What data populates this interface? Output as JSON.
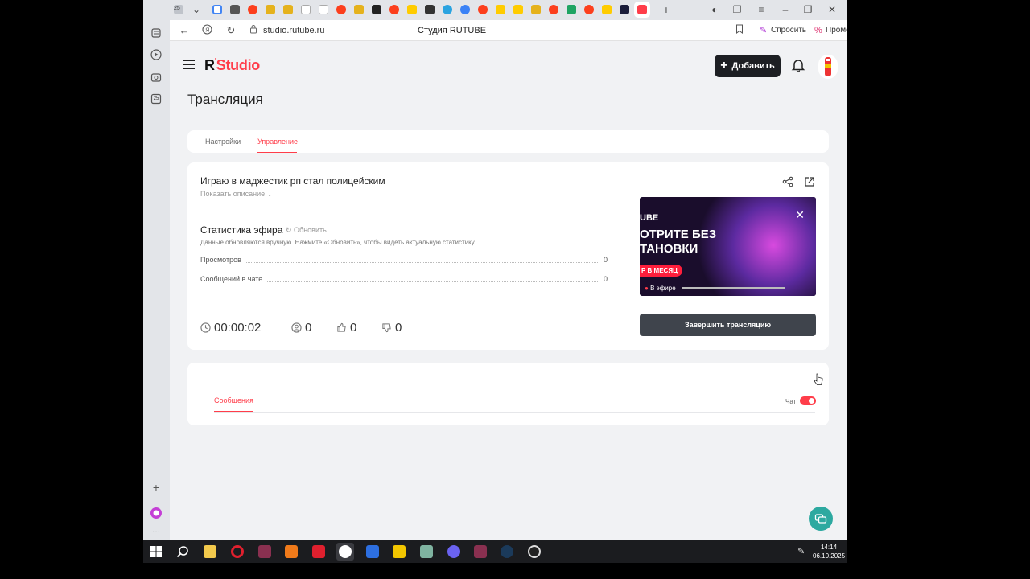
{
  "browser": {
    "url": "studio.rutube.ru",
    "page_title": "Студия RUTUBE",
    "ask_label": "Спросить",
    "promo_label": "Промокоды",
    "tab_badge": "25",
    "sidebar_badge": "25"
  },
  "studio": {
    "logo_r": "R",
    "logo_text": "Studio",
    "add_button": "Добавить",
    "page_heading": "Трансляция",
    "tabs": [
      {
        "label": "Настройки"
      },
      {
        "label": "Управление"
      }
    ],
    "stream": {
      "title": "Играю в маджестик рп стал полицейским",
      "show_description": "Показать описание",
      "stats_title": "Статистика эфира",
      "refresh_label": "Обновить",
      "stats_note": "Данные обновляются вручную. Нажмите «Обновить», чтобы видеть актуальную статистику",
      "stats": [
        {
          "label": "Просмотров",
          "value": "0"
        },
        {
          "label": "Сообщений в чате",
          "value": "0"
        }
      ],
      "duration": "00:00:02",
      "viewers": "0",
      "likes": "0",
      "dislikes": "0",
      "end_button": "Завершить трансляцию",
      "preview": {
        "line1": "UBE",
        "line2a": "ОТРИТЕ БЕЗ",
        "line2b": "ТАНОВКИ",
        "badge": "Р В МЕСЯЦ",
        "live": "В эфире"
      }
    },
    "chat": {
      "tab_label": "Сообщения",
      "toggle_label": "Чат",
      "toggle_on": true
    }
  },
  "taskbar": {
    "time": "14:14",
    "date": "06.10.2025"
  },
  "colors": {
    "accent": "#ff3d4a",
    "dark_button": "#1d1f23",
    "end_button": "#3f444c",
    "help_fab": "#2da9a0"
  }
}
